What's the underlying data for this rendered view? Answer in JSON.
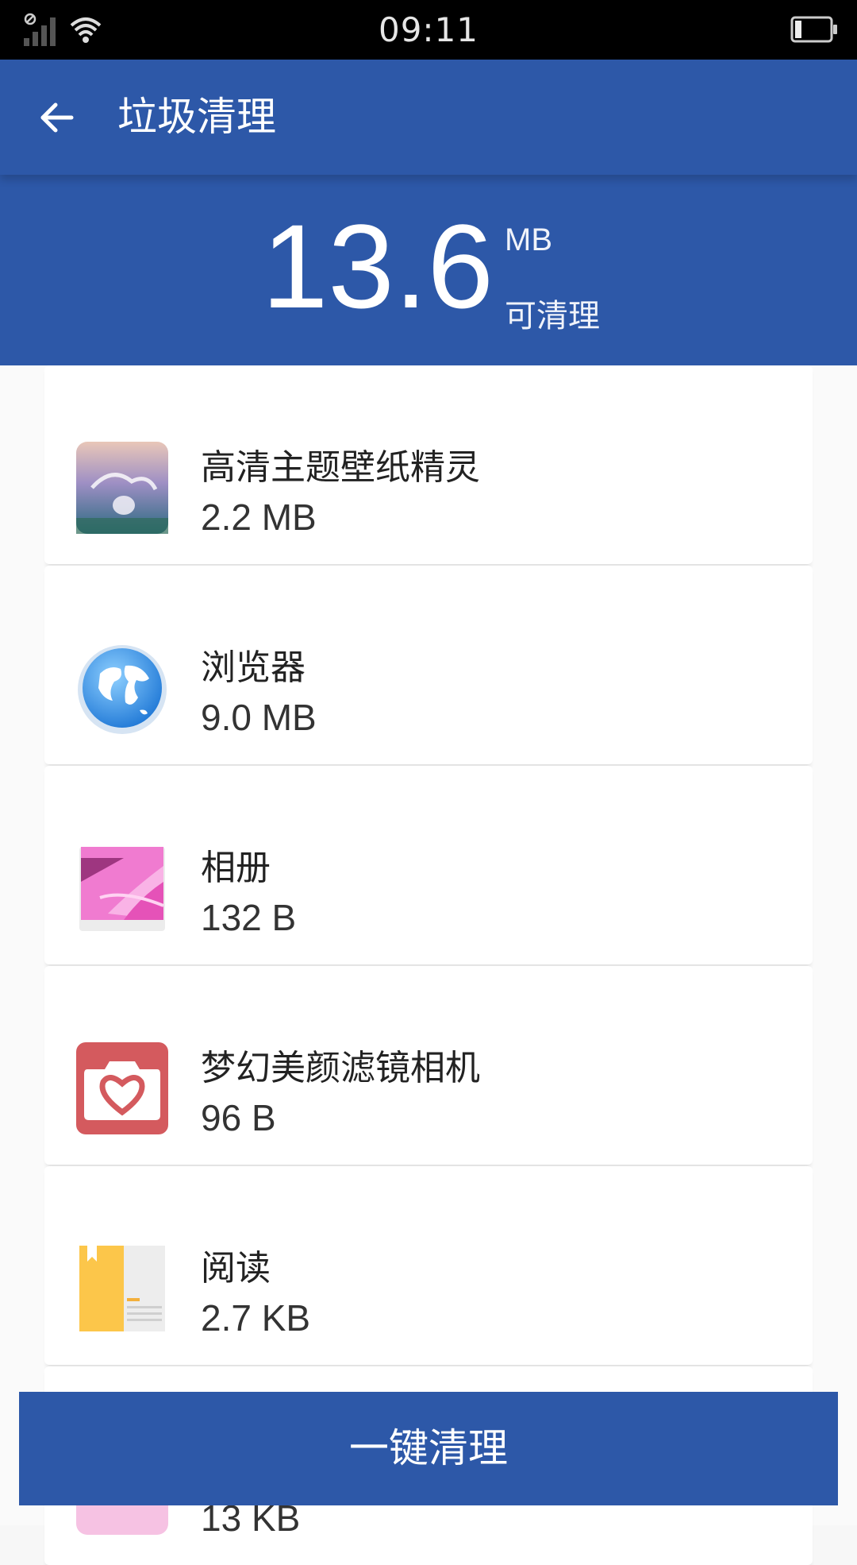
{
  "status_bar": {
    "time": "09:11"
  },
  "app_bar": {
    "title": "垃圾清理"
  },
  "summary": {
    "amount": "13.6",
    "unit": "MB",
    "caption": "可清理"
  },
  "items": [
    {
      "name": "高清主题壁纸精灵",
      "size": "2.2 MB",
      "icon": "wallpaper-app-icon"
    },
    {
      "name": "浏览器",
      "size": "9.0 MB",
      "icon": "browser-globe-icon"
    },
    {
      "name": "相册",
      "size": "132 B",
      "icon": "gallery-flower-icon"
    },
    {
      "name": "梦幻美颜滤镜相机",
      "size": "96 B",
      "icon": "camera-heart-icon"
    },
    {
      "name": "阅读",
      "size": "2.7 KB",
      "icon": "reader-book-icon"
    },
    {
      "name": "",
      "size": "13 KB",
      "icon": "partial-app-icon"
    }
  ],
  "clean_button": {
    "label": "一键清理"
  },
  "colors": {
    "primary": "#2d58a8"
  }
}
